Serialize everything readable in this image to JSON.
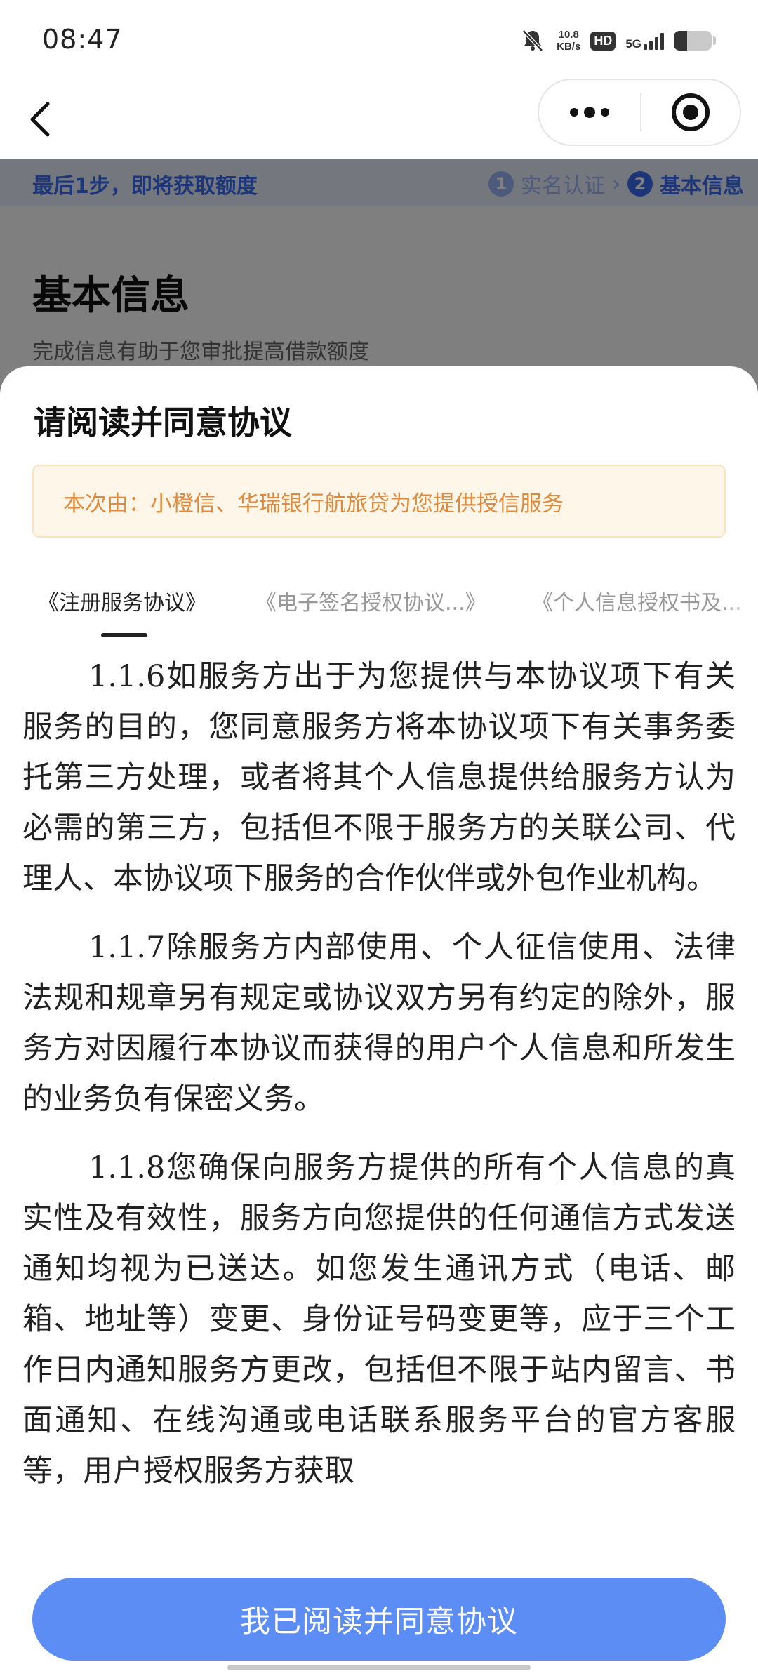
{
  "status_bar": {
    "time": "08:47",
    "net_speed_value": "10.8",
    "net_speed_unit": "KB/s",
    "hd_label": "HD",
    "network_label": "5G",
    "battery_level": 0.35
  },
  "nav": {
    "back_icon": "chevron-left-icon",
    "more_icon": "more-dots-icon",
    "close_icon": "target-icon"
  },
  "progress": {
    "title": "最后1步，即将获取额度",
    "steps": [
      {
        "num": "1",
        "label": "实名认证"
      },
      {
        "num": "2",
        "label": "基本信息"
      }
    ]
  },
  "page": {
    "title": "基本信息",
    "subtitle": "完成信息有助于您审批提高借款额度"
  },
  "sheet": {
    "title": "请阅读并同意协议",
    "notice": "本次由：小橙信、华瑞银行航旅贷为您提供授信服务",
    "tabs": [
      {
        "label": "《注册服务协议》"
      },
      {
        "label": "《电子签名授权协议...》"
      },
      {
        "label": "《个人信息授权书及..."
      }
    ],
    "paragraphs": [
      "1.1.6如服务方出于为您提供与本协议项下有关服务的目的，您同意服务方将本协议项下有关事务委托第三方处理，或者将其个人信息提供给服务方认为必需的第三方，包括但不限于服务方的关联公司、代理人、本协议项下服务的合作伙伴或外包作业机构。",
      "1.1.7除服务方内部使用、个人征信使用、法律法规和规章另有规定或协议双方另有约定的除外，服务方对因履行本协议而获得的用户个人信息和所发生的业务负有保密义务。",
      "1.1.8您确保向服务方提供的所有个人信息的真实性及有效性，服务方向您提供的任何通信方式发送通知均视为已送达。如您发生通讯方式（电话、邮箱、地址等）变更、身份证号码变更等，应于三个工作日内通知服务方更改，包括但不限于站内留言、书面通知、在线沟通或电话联系服务平台的官方客服等，用户授权服务方获取"
    ],
    "agree_button": "我已阅读并同意协议"
  },
  "colors": {
    "accent": "#3a6cf4",
    "button": "#5b8df5",
    "notice_text": "#e08a3c",
    "notice_bg": "#fff6ea"
  }
}
